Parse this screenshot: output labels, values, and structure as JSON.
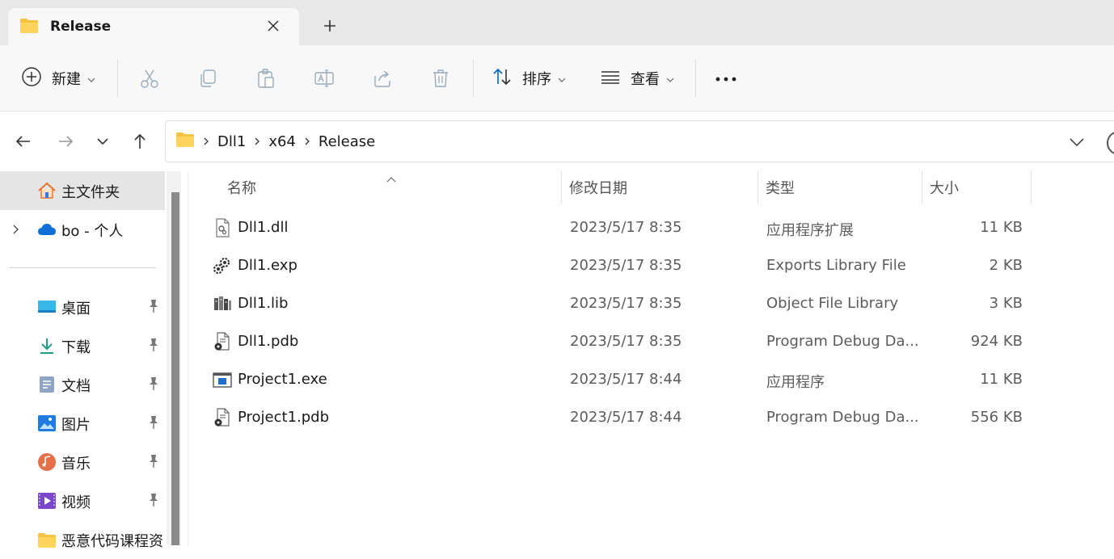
{
  "tab": {
    "title": "Release"
  },
  "toolbar": {
    "new_label": "新建",
    "sort_label": "排序",
    "view_label": "查看",
    "more_label": "•••"
  },
  "breadcrumb": [
    "Dll1",
    "x64",
    "Release"
  ],
  "sidebar": {
    "items": [
      {
        "label": "主文件夹",
        "icon": "home-icon"
      },
      {
        "label": "bo - 个人",
        "icon": "onedrive-cloud-icon"
      },
      {
        "label": "桌面",
        "icon": "desktop-icon",
        "pinned": true
      },
      {
        "label": "下载",
        "icon": "download-icon",
        "pinned": true
      },
      {
        "label": "文档",
        "icon": "documents-icon",
        "pinned": true
      },
      {
        "label": "图片",
        "icon": "pictures-icon",
        "pinned": true
      },
      {
        "label": "音乐",
        "icon": "music-icon",
        "pinned": true
      },
      {
        "label": "视频",
        "icon": "videos-icon",
        "pinned": true
      },
      {
        "label": "恶意代码课程资",
        "icon": "folder-icon"
      }
    ]
  },
  "columns": {
    "name": "名称",
    "modified": "修改日期",
    "type": "类型",
    "size": "大小"
  },
  "files": [
    {
      "name": "Dll1.dll",
      "modified": "2023/5/17 8:35",
      "type": "应用程序扩展",
      "size": "11 KB",
      "icon": "dll-file-icon"
    },
    {
      "name": "Dll1.exp",
      "modified": "2023/5/17 8:35",
      "type": "Exports Library File",
      "size": "2 KB",
      "icon": "exp-file-icon"
    },
    {
      "name": "Dll1.lib",
      "modified": "2023/5/17 8:35",
      "type": "Object File Library",
      "size": "3 KB",
      "icon": "lib-file-icon"
    },
    {
      "name": "Dll1.pdb",
      "modified": "2023/5/17 8:35",
      "type": "Program Debug Da...",
      "size": "924 KB",
      "icon": "pdb-file-icon"
    },
    {
      "name": "Project1.exe",
      "modified": "2023/5/17 8:44",
      "type": "应用程序",
      "size": "11 KB",
      "icon": "exe-file-icon"
    },
    {
      "name": "Project1.pdb",
      "modified": "2023/5/17 8:44",
      "type": "Program Debug Da...",
      "size": "556 KB",
      "icon": "pdb-file-icon"
    }
  ],
  "colors": {
    "folder": "#f5c242",
    "accent": "#0067c0",
    "selected_bg": "#e5e5e5"
  }
}
